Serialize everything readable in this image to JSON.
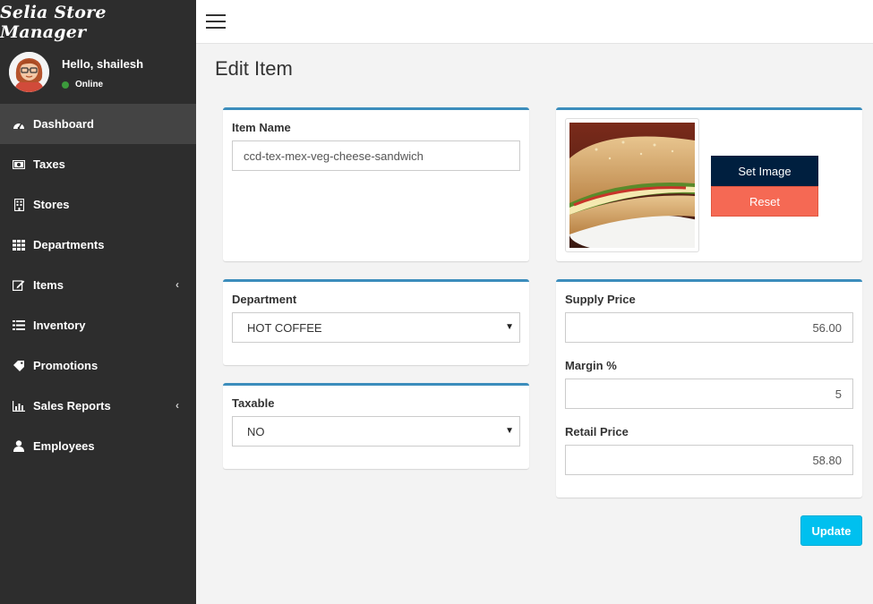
{
  "app": {
    "brand": "Selia Store Manager"
  },
  "user": {
    "greeting": "Hello, shailesh",
    "status": "Online"
  },
  "sidebar": {
    "items": [
      {
        "label": "Dashboard",
        "icon": "dashboard-icon",
        "active": true
      },
      {
        "label": "Taxes",
        "icon": "money-icon"
      },
      {
        "label": "Stores",
        "icon": "building-icon"
      },
      {
        "label": "Departments",
        "icon": "grid-icon"
      },
      {
        "label": "Items",
        "icon": "edit-icon",
        "has_submenu": true
      },
      {
        "label": "Inventory",
        "icon": "list-icon"
      },
      {
        "label": "Promotions",
        "icon": "tag-icon"
      },
      {
        "label": "Sales Reports",
        "icon": "bar-chart-icon",
        "has_submenu": true
      },
      {
        "label": "Employees",
        "icon": "user-icon"
      }
    ]
  },
  "page": {
    "title": "Edit Item"
  },
  "form": {
    "item_name": {
      "label": "Item Name",
      "value": "ccd-tex-mex-veg-cheese-sandwich"
    },
    "department": {
      "label": "Department",
      "value": "HOT COFFEE"
    },
    "taxable": {
      "label": "Taxable",
      "value": "NO"
    },
    "supply_price": {
      "label": "Supply Price",
      "value": "56.00"
    },
    "margin": {
      "label": "Margin %",
      "value": "5"
    },
    "retail_price": {
      "label": "Retail Price",
      "value": "58.80"
    },
    "set_image_label": "Set Image",
    "reset_label": "Reset",
    "update_label": "Update"
  },
  "colors": {
    "sidebar_bg": "#2d2d2d",
    "box_border": "#3c8dbc",
    "set_image_btn": "#001f3f",
    "reset_btn": "#f56954",
    "update_btn": "#00c0ef"
  }
}
